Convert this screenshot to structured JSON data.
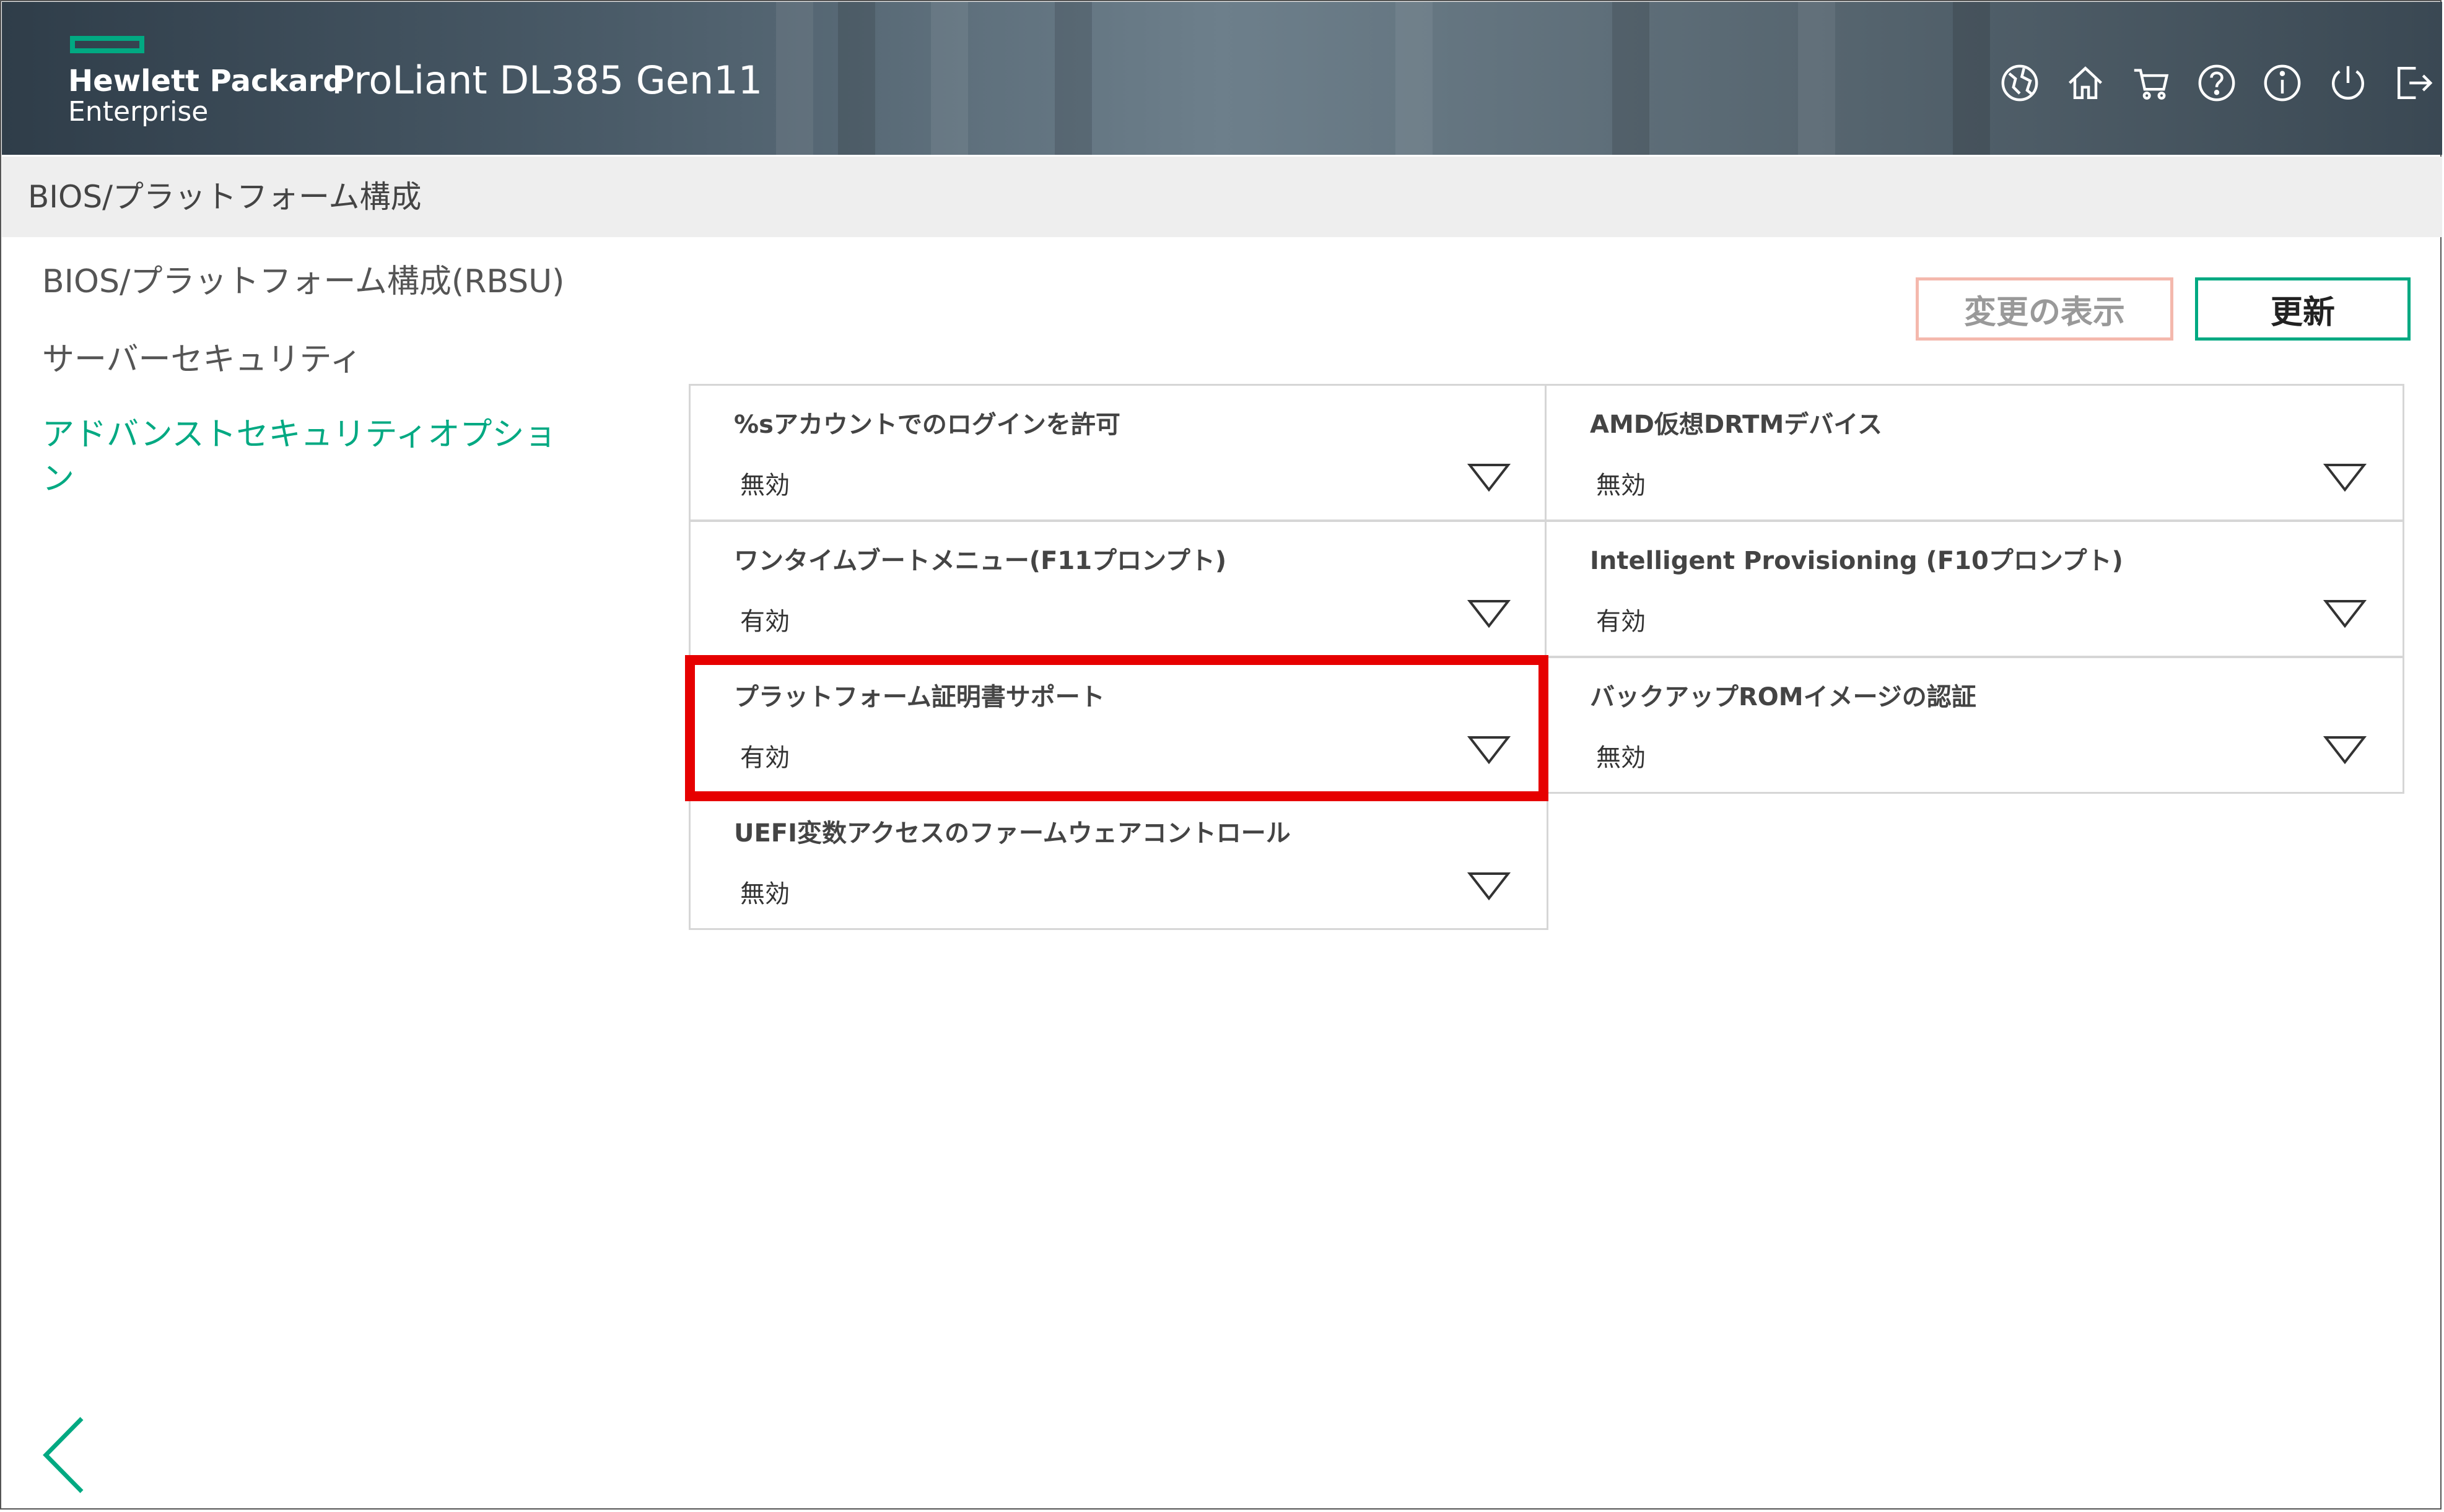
{
  "header": {
    "brand_line1": "Hewlett Packard",
    "brand_line2": "Enterprise",
    "product": "ProLiant DL385 Gen11",
    "brand_color": "#01a982",
    "icons": [
      "globe-icon",
      "home-icon",
      "cart-icon",
      "help-icon",
      "info-icon",
      "power-icon",
      "logout-icon"
    ]
  },
  "breadcrumb": "BIOS/プラットフォーム構成",
  "nav": {
    "items": [
      {
        "label": "BIOS/プラットフォーム構成(RBSU)"
      },
      {
        "label": "サーバーセキュリティ"
      },
      {
        "label": "アドバンストセキュリティオプション",
        "active": true
      }
    ]
  },
  "actions": {
    "show_changes": "変更の表示",
    "update": "更新"
  },
  "settings": [
    {
      "label": "%sアカウントでのログインを許可",
      "value": "無効"
    },
    {
      "label": "AMD仮想DRTMデバイス",
      "value": "無効"
    },
    {
      "label": "ワンタイムブートメニュー(F11プロンプト)",
      "value": "有効"
    },
    {
      "label": "Intelligent Provisioning (F10プロンプト)",
      "value": "有効"
    },
    {
      "label": "プラットフォーム証明書サポート",
      "value": "有効",
      "highlighted": true
    },
    {
      "label": "バックアップROMイメージの認証",
      "value": "無効"
    },
    {
      "label": "UEFI変数アクセスのファームウェアコントロール",
      "value": "無効"
    }
  ],
  "highlight_color": "#e60000"
}
